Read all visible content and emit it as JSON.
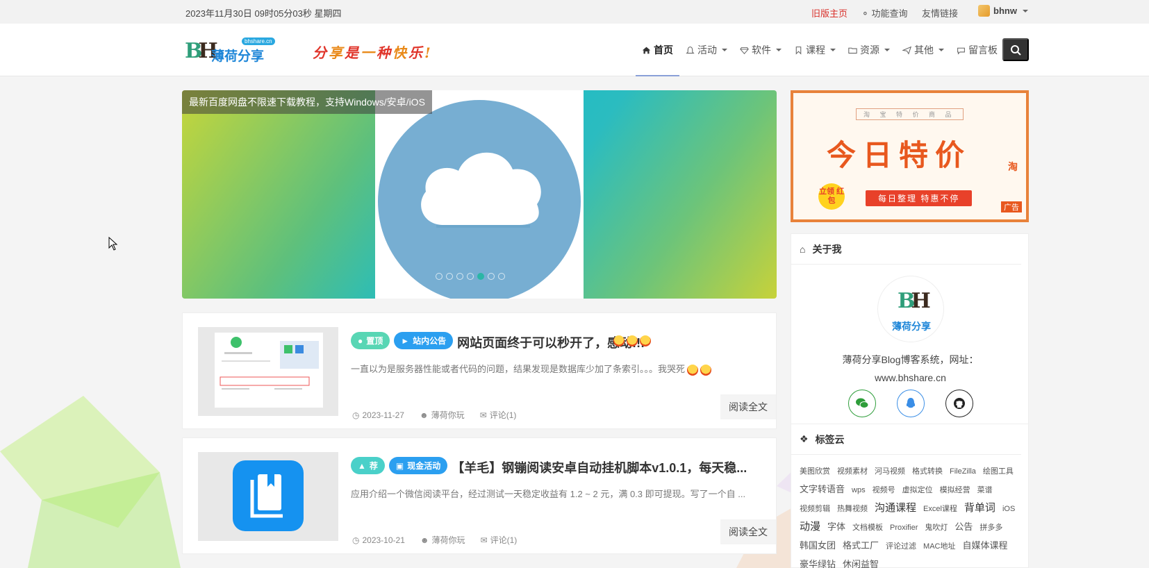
{
  "topbar": {
    "datetime": "2023年11月30日 09时05分03秒 星期四",
    "old_home": "旧版主页",
    "function_query": "功能查询",
    "friend_links": "友情链接",
    "username": "bhnw"
  },
  "header": {
    "logo_text": "薄荷分享",
    "logo_pill": "bhshare.cn",
    "slogan": [
      "分",
      "享",
      "是",
      "一",
      "种",
      "快",
      "乐",
      "!"
    ],
    "nav": [
      {
        "label": "首页",
        "icon": "home-icon",
        "active": true
      },
      {
        "label": "活动",
        "icon": "bell-icon",
        "dropdown": true
      },
      {
        "label": "软件",
        "icon": "diamond-icon",
        "dropdown": true
      },
      {
        "label": "课程",
        "icon": "bookmark-icon",
        "dropdown": true
      },
      {
        "label": "资源",
        "icon": "folder-icon",
        "dropdown": true
      },
      {
        "label": "其他",
        "icon": "send-icon",
        "dropdown": true
      },
      {
        "label": "留言板",
        "icon": "chat-icon"
      }
    ]
  },
  "slider": {
    "caption": "最新百度网盘不限速下载教程，支持Windows/安卓/iOS",
    "active_dot": 4,
    "dot_count": 7
  },
  "posts": [
    {
      "badges": [
        {
          "label": "置顶",
          "color": "green"
        },
        {
          "label": "站内公告",
          "color": "blue"
        }
      ],
      "title": "网站页面终于可以秒开了，感动!!!",
      "excerpt": "一直以为是服务器性能或者代码的问题，结果发现是数据库少加了条索引。。。我哭死",
      "date": "2023-11-27",
      "author": "薄荷你玩",
      "comments": "评论(1)",
      "read_more": "阅读全文"
    },
    {
      "badges": [
        {
          "label": "荐",
          "color": "teal"
        },
        {
          "label": "现金活动",
          "color": "blue"
        }
      ],
      "title": "【羊毛】钢镚阅读安卓自动挂机脚本v1.0.1，每天稳...",
      "excerpt": "应用介绍一个微信阅读平台，经过测试一天稳定收益有 1.2 ~ 2 元，满 0.3 即可提现。写了一个自 ...",
      "date": "2023-10-21",
      "author": "薄荷你玩",
      "comments": "评论(1)",
      "read_more": "阅读全文"
    }
  ],
  "ad": {
    "top_line": "淘 宝 特 价 商 品",
    "main": "今日特价",
    "bar": "每日整理 特惠不停",
    "coin": "立领 红包",
    "tao": "淘",
    "adtag": "广告"
  },
  "about": {
    "heading": "关于我",
    "logo_text": "薄荷分享",
    "desc_line1": "薄荷分享Blog博客系统，网址：",
    "desc_line2": "www.bhshare.cn"
  },
  "tagcloud": {
    "heading": "标签云",
    "tags": [
      {
        "t": "美图欣赏",
        "s": "s"
      },
      {
        "t": "视频素材",
        "s": "s"
      },
      {
        "t": "河马视频",
        "s": "s"
      },
      {
        "t": "格式转换",
        "s": "s"
      },
      {
        "t": "FileZilla",
        "s": "s"
      },
      {
        "t": "绘图工具",
        "s": "s"
      },
      {
        "t": "文字转语音",
        "s": "m"
      },
      {
        "t": "wps",
        "s": "s"
      },
      {
        "t": "视频号",
        "s": "s"
      },
      {
        "t": "虚拟定位",
        "s": "s"
      },
      {
        "t": "模拟经营",
        "s": "s"
      },
      {
        "t": "菜谱",
        "s": "s"
      },
      {
        "t": "视频剪辑",
        "s": "s"
      },
      {
        "t": "热舞视频",
        "s": "s"
      },
      {
        "t": "沟通课程",
        "s": "l"
      },
      {
        "t": "Excel课程",
        "s": "s"
      },
      {
        "t": "背单词",
        "s": "l"
      },
      {
        "t": "iOS",
        "s": "s"
      },
      {
        "t": "动漫",
        "s": "l"
      },
      {
        "t": "字体",
        "s": "m"
      },
      {
        "t": "文档模板",
        "s": "s"
      },
      {
        "t": "Proxifier",
        "s": "s"
      },
      {
        "t": "鬼吹灯",
        "s": "s"
      },
      {
        "t": "公告",
        "s": "m"
      },
      {
        "t": "拼多多",
        "s": "s"
      },
      {
        "t": "韩国女团",
        "s": "m"
      },
      {
        "t": "格式工厂",
        "s": "m"
      },
      {
        "t": "评论过滤",
        "s": "s"
      },
      {
        "t": "MAC地址",
        "s": "s"
      },
      {
        "t": "自媒体课程",
        "s": "m"
      },
      {
        "t": "豪华绿钻",
        "s": "m"
      },
      {
        "t": "休闲益智",
        "s": "m"
      }
    ]
  },
  "colors": {
    "accent_red": "#d9302a",
    "badge_green": "#58d6b4",
    "badge_blue": "#2b9ff0",
    "ad_orange": "#e8823a"
  }
}
